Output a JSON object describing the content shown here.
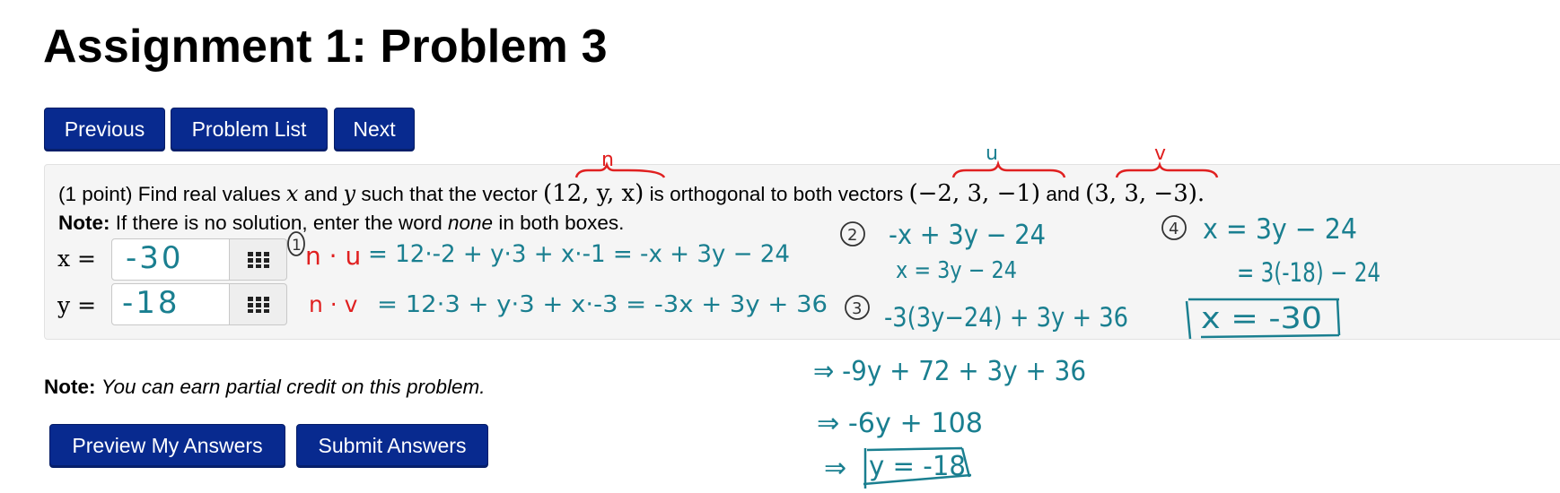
{
  "page": {
    "title": "Assignment 1: Problem 3"
  },
  "nav": {
    "previous": "Previous",
    "problem_list": "Problem List",
    "next": "Next"
  },
  "problem": {
    "points": "(1 point) Find real values",
    "var_x": "x",
    "and1": "and",
    "var_y": "y",
    "mid": "such that the vector",
    "vector_n": "(12, y, x)",
    "orth": "is orthogonal to both vectors",
    "vector_u": "(−2, 3, −1)",
    "and2": "and",
    "vector_v": "(3, 3, −3).",
    "note_label": "Note:",
    "note_text1": "If there is no solution, enter the word",
    "note_italic": "none",
    "note_text2": "in both boxes."
  },
  "answers": {
    "x_label": "x =",
    "y_label": "y =",
    "x_value": "-30",
    "y_value": "-18",
    "pad_icon": "keypad-grid-icon"
  },
  "footer": {
    "note_label": "Note:",
    "note_text": "You can earn partial credit on this problem.",
    "preview": "Preview My Answers",
    "submit": "Submit Answers"
  },
  "handwriting": {
    "brace_n": "n",
    "brace_u": "u",
    "brace_v": "v",
    "step1_num": "1",
    "step1_lhs": "n · u",
    "step1_rhs": "= 12·-2 + y·3 + x·-1 = -x + 3y − 24",
    "step1b_lhs": "n · v",
    "step1b_rhs": "= 12·3 + y·3 + x·-3 = -3x + 3y + 36",
    "step2_num": "2",
    "step2a": "-x + 3y − 24",
    "step2b": "x = 3y − 24",
    "step3_num": "3",
    "step3a": "-3(3y−24) + 3y + 36",
    "step3b": "⇒ -9y + 72 + 3y + 36",
    "step3c": "⇒ -6y + 108",
    "step3d_arrow": "⇒",
    "step3d": "y = -18",
    "step4_num": "4",
    "step4a": "x = 3y − 24",
    "step4b": "= 3(-18) − 24",
    "step4c": "x = -30",
    "colors": {
      "ink_teal": "#1a7f90",
      "ink_red": "#e02020"
    }
  },
  "colors": {
    "button_bg": "#082a8f",
    "box_bg": "#f5f5f5"
  }
}
